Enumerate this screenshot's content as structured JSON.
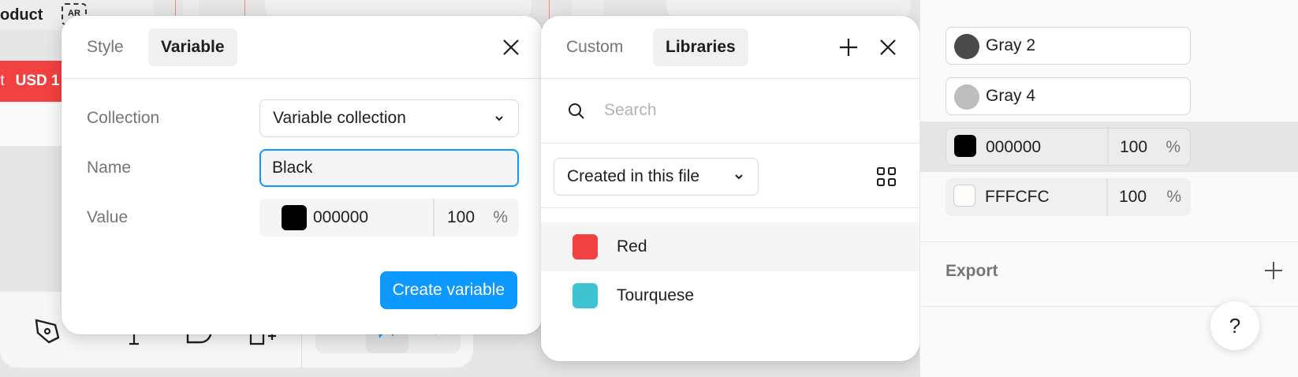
{
  "background": {
    "product_label": "oduct",
    "ar_badge": "AR",
    "price_prefix": "rt",
    "price_label": "USD 1"
  },
  "create_variable": {
    "tabs": [
      {
        "label": "Style",
        "active": false
      },
      {
        "label": "Variable",
        "active": true
      }
    ],
    "collection_label": "Collection",
    "collection_value": "Variable collection",
    "name_label": "Name",
    "name_value": "Black",
    "value_label": "Value",
    "value_hex": "000000",
    "value_opacity": "100",
    "value_percent": "%",
    "create_button": "Create variable",
    "swatch_color": "#000000"
  },
  "libraries": {
    "tabs": [
      {
        "label": "Custom",
        "active": false
      },
      {
        "label": "Libraries",
        "active": true
      }
    ],
    "search_placeholder": "Search",
    "filter_value": "Created in this file",
    "items": [
      {
        "label": "Red",
        "color": "#f24141"
      },
      {
        "label": "Tourquese",
        "color": "#3ec3d3"
      }
    ]
  },
  "right_panel": {
    "styles": [
      {
        "name": "Gray 2",
        "color": "#4a4a4a"
      },
      {
        "name": "Gray 4",
        "color": "#bdbdbd"
      }
    ],
    "fills": [
      {
        "hex": "000000",
        "opacity": "100",
        "percent": "%",
        "color": "#000000"
      },
      {
        "hex": "FFFCFC",
        "opacity": "100",
        "percent": "%",
        "color": "#fffcfc"
      }
    ],
    "export_label": "Export",
    "help_label": "?"
  },
  "colors": {
    "accent": "#0d99ff",
    "red": "#f24141"
  }
}
